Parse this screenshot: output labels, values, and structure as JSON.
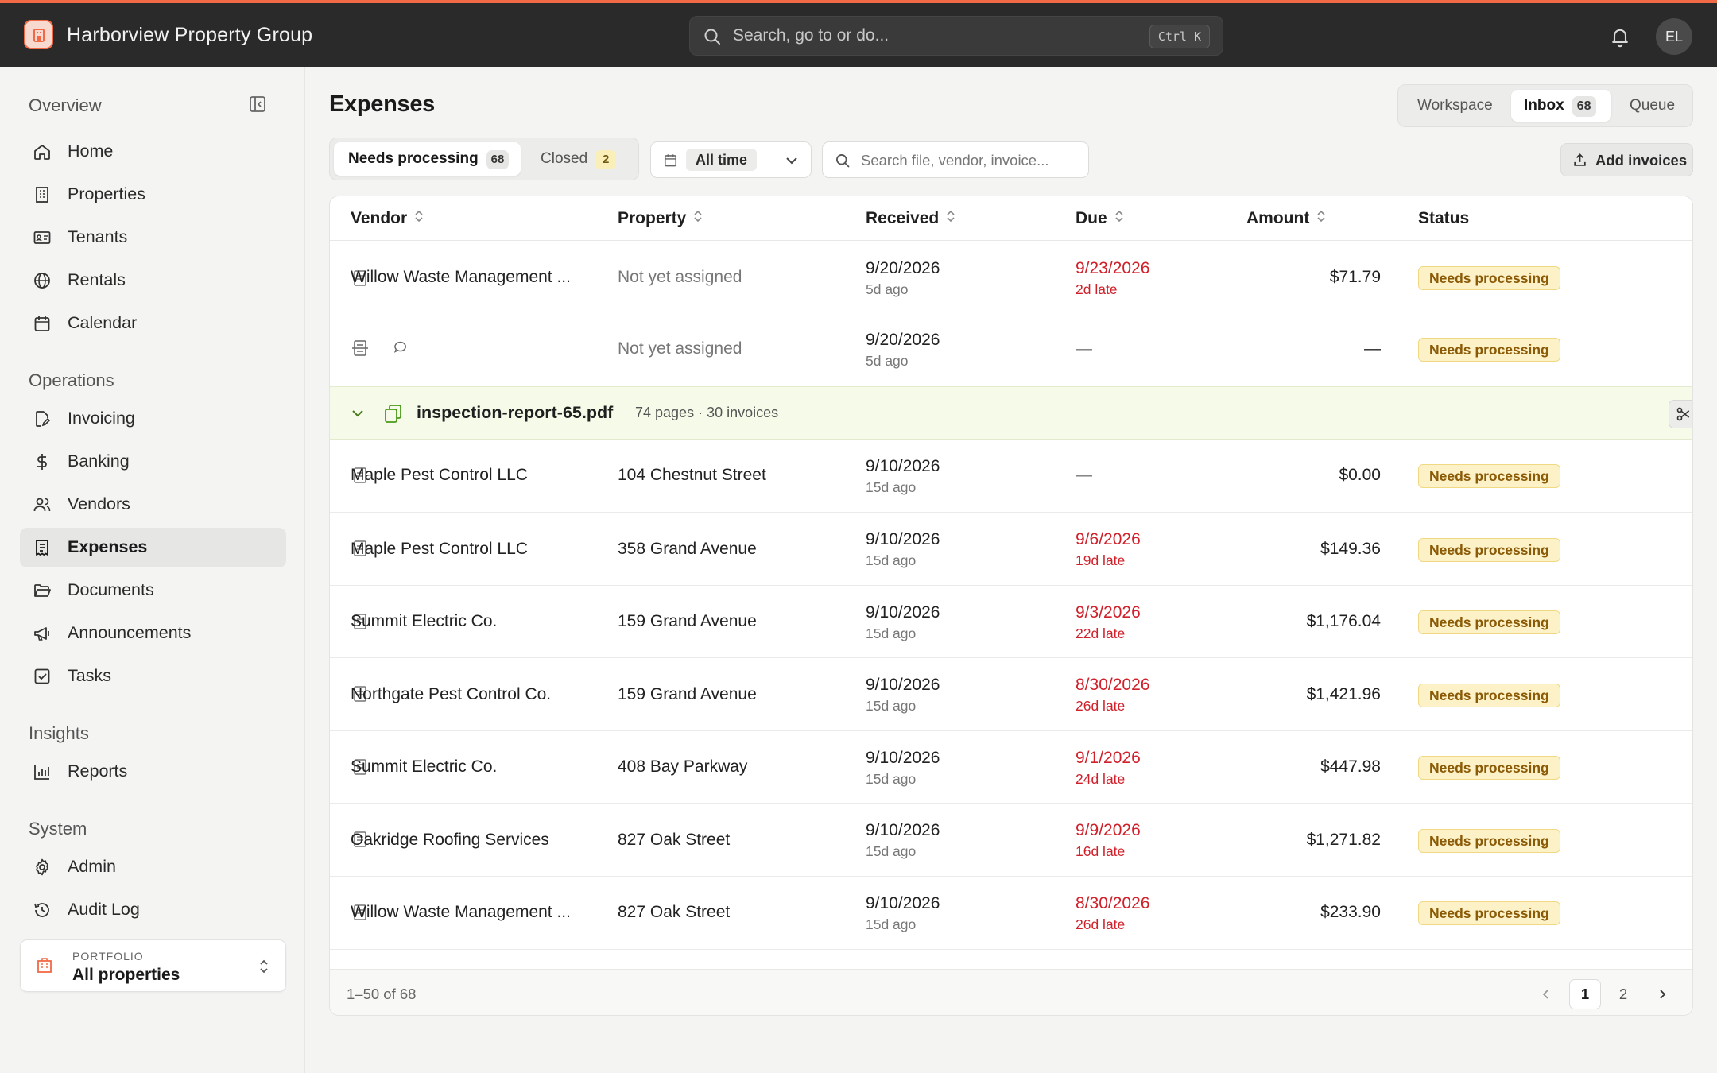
{
  "app": {
    "title": "Harborview Property Group",
    "avatar_initials": "EL"
  },
  "search": {
    "placeholder": "Search, go to or do...",
    "shortcut": "Ctrl K"
  },
  "sidebar": {
    "sections": [
      {
        "label": "Overview",
        "items": [
          {
            "label": "Home",
            "icon": "home-icon"
          },
          {
            "label": "Properties",
            "icon": "building-icon"
          },
          {
            "label": "Tenants",
            "icon": "id-card-icon"
          },
          {
            "label": "Rentals",
            "icon": "globe-icon"
          },
          {
            "label": "Calendar",
            "icon": "calendar-icon"
          }
        ]
      },
      {
        "label": "Operations",
        "items": [
          {
            "label": "Invoicing",
            "icon": "file-edit-icon"
          },
          {
            "label": "Banking",
            "icon": "dollar-icon"
          },
          {
            "label": "Vendors",
            "icon": "users-icon"
          },
          {
            "label": "Expenses",
            "icon": "receipt-icon",
            "active": true
          },
          {
            "label": "Documents",
            "icon": "folder-icon"
          },
          {
            "label": "Announcements",
            "icon": "megaphone-icon"
          },
          {
            "label": "Tasks",
            "icon": "checkbox-icon"
          }
        ]
      },
      {
        "label": "Insights",
        "items": [
          {
            "label": "Reports",
            "icon": "bar-chart-icon"
          }
        ]
      },
      {
        "label": "System",
        "items": [
          {
            "label": "Admin",
            "icon": "gear-icon"
          },
          {
            "label": "Audit Log",
            "icon": "history-icon"
          }
        ]
      }
    ],
    "portfolio": {
      "caption": "PORTFOLIO",
      "value": "All properties"
    }
  },
  "page": {
    "title": "Expenses"
  },
  "view_switch": [
    {
      "label": "Workspace"
    },
    {
      "label": "Inbox",
      "count": "68",
      "active": true
    },
    {
      "label": "Queue"
    }
  ],
  "tabs": [
    {
      "label": "Needs processing",
      "count": "68",
      "active": true
    },
    {
      "label": "Closed",
      "count": "2"
    }
  ],
  "date_filter": {
    "value": "All time"
  },
  "file_search": {
    "placeholder": "Search file, vendor, invoice..."
  },
  "add_button": {
    "label": "Add invoices"
  },
  "table": {
    "columns": [
      "Vendor",
      "Property",
      "Received",
      "Due",
      "Amount",
      "Status"
    ],
    "rows_top": [
      {
        "vendor": "Willow Waste Management ...",
        "property": "Not yet assigned",
        "received": "9/20/2026",
        "received_ago": "5d ago",
        "due": "9/23/2026",
        "due_late": "2d late",
        "amount": "$71.79",
        "status": "Needs processing"
      },
      {
        "vendor": "",
        "property": "Not yet assigned",
        "received": "9/20/2026",
        "received_ago": "5d ago",
        "due": "—",
        "due_late": "",
        "amount": "—",
        "status": "Needs processing"
      }
    ],
    "group": {
      "file": "inspection-report-65.pdf",
      "meta": "74 pages · 30 invoices"
    },
    "rows_group": [
      {
        "vendor": "Maple Pest Control LLC",
        "property": "104 Chestnut Street",
        "received": "9/10/2026",
        "received_ago": "15d ago",
        "due": "—",
        "due_late": "",
        "amount": "$0.00",
        "status": "Needs processing"
      },
      {
        "vendor": "Maple Pest Control LLC",
        "property": "358 Grand Avenue",
        "received": "9/10/2026",
        "received_ago": "15d ago",
        "due": "9/6/2026",
        "due_late": "19d late",
        "amount": "$149.36",
        "status": "Needs processing"
      },
      {
        "vendor": "Summit Electric Co.",
        "property": "159 Grand Avenue",
        "received": "9/10/2026",
        "received_ago": "15d ago",
        "due": "9/3/2026",
        "due_late": "22d late",
        "amount": "$1,176.04",
        "status": "Needs processing"
      },
      {
        "vendor": "Northgate Pest Control Co.",
        "property": "159 Grand Avenue",
        "received": "9/10/2026",
        "received_ago": "15d ago",
        "due": "8/30/2026",
        "due_late": "26d late",
        "amount": "$1,421.96",
        "status": "Needs processing"
      },
      {
        "vendor": "Summit Electric Co.",
        "property": "408 Bay Parkway",
        "received": "9/10/2026",
        "received_ago": "15d ago",
        "due": "9/1/2026",
        "due_late": "24d late",
        "amount": "$447.98",
        "status": "Needs processing"
      },
      {
        "vendor": "Oakridge Roofing Services",
        "property": "827 Oak Street",
        "received": "9/10/2026",
        "received_ago": "15d ago",
        "due": "9/9/2026",
        "due_late": "16d late",
        "amount": "$1,271.82",
        "status": "Needs processing"
      },
      {
        "vendor": "Willow Waste Management ...",
        "property": "827 Oak Street",
        "received": "9/10/2026",
        "received_ago": "15d ago",
        "due": "8/30/2026",
        "due_late": "26d late",
        "amount": "$233.90",
        "status": "Needs processing"
      }
    ],
    "footer": {
      "range": "1–50 of 68",
      "pages": [
        "1",
        "2"
      ],
      "current_page": "1"
    }
  },
  "colors": {
    "accent": "#f26a45",
    "topbar": "#2a2a2a",
    "late": "#d0202a",
    "status_bg": "#fdf2c7",
    "group_bg": "#f5fbe8"
  }
}
